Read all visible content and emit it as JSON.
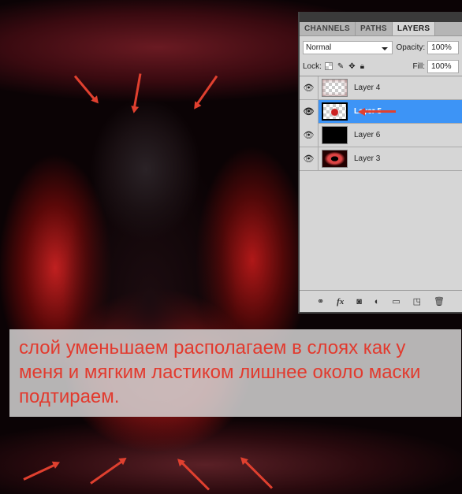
{
  "panel": {
    "tabs": [
      "CHANNELS",
      "PATHS",
      "LAYERS"
    ],
    "active_tab": "LAYERS",
    "blend_mode": "Normal",
    "opacity_label": "Opacity:",
    "opacity": "100%",
    "lock_label": "Lock:",
    "fill_label": "Fill:",
    "fill": "100%",
    "layers": [
      {
        "name": "Layer 4"
      },
      {
        "name": "Layer 5",
        "selected": true
      },
      {
        "name": "Layer 6"
      },
      {
        "name": "Layer 3"
      }
    ],
    "bottom_icons": [
      "link-icon",
      "fx-icon",
      "mask-icon",
      "adjustment-icon",
      "folder-icon",
      "new-layer-icon",
      "trash-icon"
    ]
  },
  "caption": "слой уменьшаем располагаем в слоях как у меня и мягким ластиком лишнее около маски подтираем.",
  "colors": {
    "accent": "#3d94f6",
    "arrow": "#e0402f",
    "caption_text": "#e23a2e"
  }
}
